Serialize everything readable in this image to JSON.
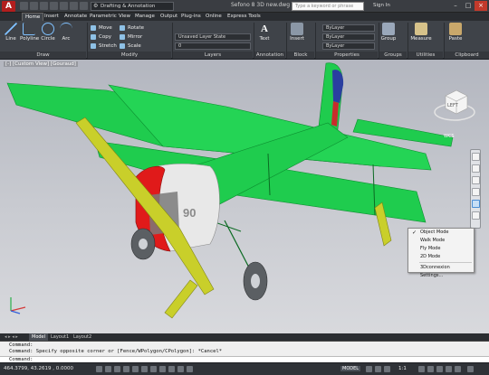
{
  "app_button": "A",
  "workspace": "Drafting & Annotation",
  "document_title": "Sefono 8 3D new.dwg",
  "search_placeholder": "Type a keyword or phrase",
  "sign_in": "Sign In",
  "tabs": [
    "Home",
    "Insert",
    "Annotate",
    "Parametric",
    "View",
    "Manage",
    "Output",
    "Plug-ins",
    "Online",
    "Express Tools"
  ],
  "ribbon": {
    "draw": {
      "title": "Draw",
      "buttons": [
        "Line",
        "Polyline",
        "Circle",
        "Arc"
      ]
    },
    "modify": {
      "title": "Modify",
      "buttons": [
        "Move",
        "Rotate",
        "Copy",
        "Mirror",
        "Stretch",
        "Scale"
      ]
    },
    "layers": {
      "title": "Layers",
      "layer_state": "Unsaved Layer State",
      "current_layer": "0"
    },
    "annotation": {
      "title": "Annotation",
      "text": "Text"
    },
    "block": {
      "title": "Block",
      "insert": "Insert"
    },
    "properties": {
      "title": "Properties",
      "rows": [
        "ByLayer",
        "ByLayer",
        "ByLayer"
      ]
    },
    "groups": {
      "title": "Groups",
      "group": "Group"
    },
    "utilities": {
      "title": "Utilities",
      "measure": "Measure"
    },
    "clipboard": {
      "title": "Clipboard",
      "paste": "Paste"
    }
  },
  "viewport_label": "[-] [Custom View] [Gouraud]",
  "viewcube": {
    "face": "LEFT",
    "wcs": "WCS"
  },
  "aircraft_marking": "90",
  "context_menu": {
    "items": [
      "Object Mode",
      "Walk Mode",
      "Fly Mode",
      "2D Mode",
      "3Dconnexion Settings..."
    ],
    "checked": "Object Mode"
  },
  "layout_tabs": [
    "Model",
    "Layout1",
    "Layout2"
  ],
  "command_lines": [
    "Command:",
    "Command: Specify opposite corner or [Fence/WPolygon/CPolygon]: *Cancel*"
  ],
  "command_prompt": "Command:",
  "status": {
    "coords": "464.3799, 43.2619 , 0.0000",
    "model": "MODEL",
    "scale": "1:1"
  },
  "colors": {
    "aircraft": "#1fcc4e",
    "cowling": "#e01a1a",
    "strut": "#c9cf2a",
    "rudder_red": "#c82c2c",
    "rudder_blue": "#2a3fa0",
    "ribbon": "#3f4349"
  }
}
